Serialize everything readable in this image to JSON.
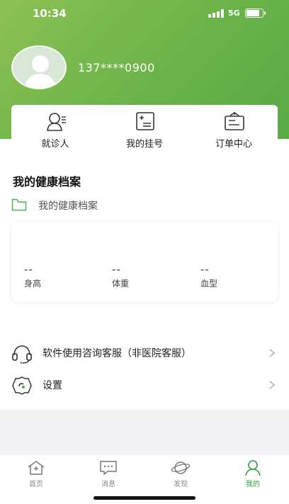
{
  "status_bar": {
    "time": "10:34",
    "network": "5G"
  },
  "profile": {
    "phone": "137****0900"
  },
  "quick_menu": [
    {
      "label": "就诊人",
      "icon": "patient-icon"
    },
    {
      "label": "我的挂号",
      "icon": "registration-icon"
    },
    {
      "label": "订单中心",
      "icon": "order-icon"
    }
  ],
  "health": {
    "title": "我的健康档案",
    "record_label": "我的健康档案",
    "metrics": [
      {
        "value": "--",
        "label": "身高"
      },
      {
        "value": "--",
        "label": "体重"
      },
      {
        "value": "--",
        "label": "血型"
      }
    ]
  },
  "list": [
    {
      "label": "软件使用咨询客服（非医院客服）",
      "icon": "headset-icon"
    },
    {
      "label": "设置",
      "icon": "settings-icon"
    }
  ],
  "tabs": [
    {
      "label": "首页",
      "icon": "home-icon",
      "active": false
    },
    {
      "label": "消息",
      "icon": "message-icon",
      "active": false
    },
    {
      "label": "发现",
      "icon": "discover-icon",
      "active": false
    },
    {
      "label": "我的",
      "icon": "profile-icon",
      "active": true
    }
  ],
  "colors": {
    "brand_green": "#6ab34a",
    "tab_active": "#2e9e3e"
  }
}
